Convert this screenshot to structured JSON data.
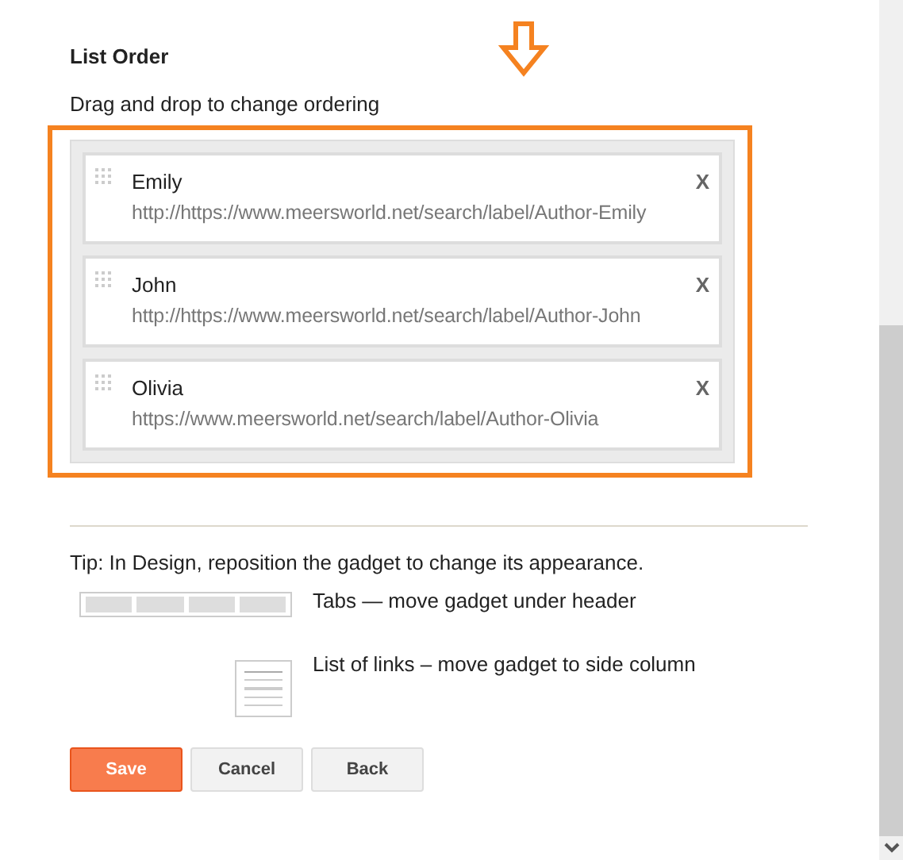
{
  "heading": "List Order",
  "instruction": "Drag and drop to change ordering",
  "items": [
    {
      "name": "Emily",
      "url": "http://https://www.meersworld.net/search/label/Author-Emily",
      "remove": "X"
    },
    {
      "name": "John",
      "url": "http://https://www.meersworld.net/search/label/Author-John",
      "remove": "X"
    },
    {
      "name": "Olivia",
      "url": "https://www.meersworld.net/search/label/Author-Olivia",
      "remove": "X"
    }
  ],
  "tip": "Tip: In Design, reposition the gadget to change its appearance.",
  "layouts": [
    {
      "kind": "tabs",
      "text": "Tabs — move gadget under header"
    },
    {
      "kind": "list",
      "text": "List of links – move gadget to side column"
    }
  ],
  "buttons": [
    {
      "label": "Save",
      "kind": "primary"
    },
    {
      "label": "Cancel",
      "kind": "secondary"
    },
    {
      "label": "Back",
      "kind": "secondary"
    }
  ]
}
